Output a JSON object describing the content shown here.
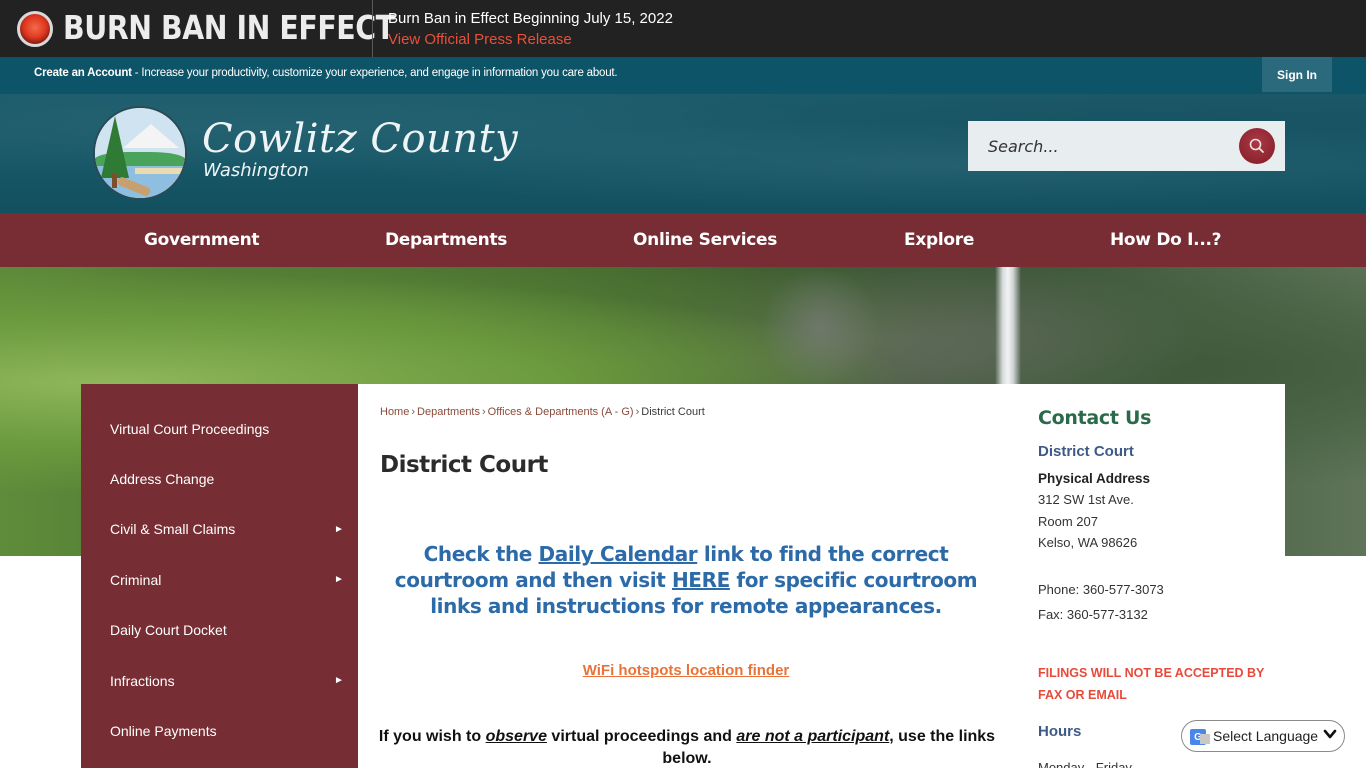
{
  "alert": {
    "title": "BURN BAN IN EFFECT",
    "message": "Burn Ban in Effect Beginning July 15, 2022",
    "link_label": "View Official Press Release",
    "status_color": "#e23b23"
  },
  "account_bar": {
    "create_account_label": "Create an Account",
    "description": " - Increase your productivity, customize your experience, and engage in information you care about.",
    "sign_in_label": "Sign In"
  },
  "header": {
    "site_title": "Cowlitz County",
    "site_subtitle": "Washington",
    "search_placeholder": "Search...",
    "search_icon": "magnifier-icon"
  },
  "nav": {
    "items": [
      {
        "label": "Government"
      },
      {
        "label": "Departments"
      },
      {
        "label": "Online Services"
      },
      {
        "label": "Explore"
      },
      {
        "label": "How Do I...?"
      }
    ]
  },
  "sidebar": {
    "items": [
      {
        "label": "Virtual Court Proceedings",
        "has_submenu": false
      },
      {
        "label": "Address Change",
        "has_submenu": false
      },
      {
        "label": "Civil & Small Claims",
        "has_submenu": true
      },
      {
        "label": "Criminal",
        "has_submenu": true
      },
      {
        "label": "Daily Court Docket",
        "has_submenu": false
      },
      {
        "label": "Infractions",
        "has_submenu": true
      },
      {
        "label": "Online Payments",
        "has_submenu": false
      }
    ],
    "submenu_icon": "►"
  },
  "breadcrumb": {
    "items": [
      {
        "label": "Home"
      },
      {
        "label": "Departments"
      },
      {
        "label": "Offices & Departments (A - G)"
      },
      {
        "label": "District Court"
      }
    ],
    "separator": "›"
  },
  "main": {
    "page_title": "District Court",
    "notice": {
      "part1": "Check the ",
      "link1": "Daily Calendar",
      "part2": " link to find the correct courtroom and then visit ",
      "link2": "HERE",
      "part3": " for specific courtroom links and instructions for remote appearances."
    },
    "wifi_link": "WiFi hotspots location finder",
    "observe": {
      "part1": "If you wish to ",
      "em1": "observe",
      "part2": " virtual proceedings and ",
      "em2": "are not a participant",
      "part3": ", use the links below."
    }
  },
  "contact": {
    "title": "Contact Us",
    "department": "District Court",
    "address_label": "Physical Address",
    "address_lines": [
      "312 SW 1st Ave.",
      "Room 207",
      "Kelso, WA 98626"
    ],
    "phone": "Phone: 360-577-3073",
    "fax": "Fax: 360-577-3132",
    "warning": "FILINGS WILL NOT BE ACCEPTED BY FAX OR EMAIL",
    "hours_title": "Hours",
    "hours_line": "Monday - Friday"
  },
  "language": {
    "label": "Select Language",
    "icon_letter": "G"
  }
}
